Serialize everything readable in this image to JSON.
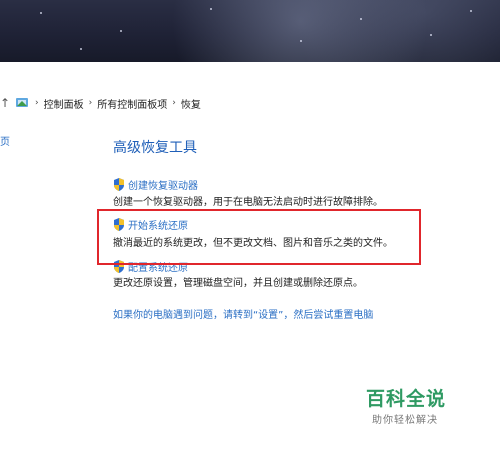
{
  "breadcrumb": {
    "items": [
      "控制面板",
      "所有控制面板项",
      "恢复"
    ]
  },
  "sidebar": {
    "cut_text": "页"
  },
  "main": {
    "heading": "高级恢复工具",
    "items": [
      {
        "link": "创建恢复驱动器",
        "desc": "创建一个恢复驱动器，用于在电脑无法启动时进行故障排除。"
      },
      {
        "link": "开始系统还原",
        "desc": "撤消最近的系统更改，但不更改文档、图片和音乐之类的文件。"
      },
      {
        "link": "配置系统还原",
        "desc": "更改还原设置，管理磁盘空间，并且创建或删除还原点。"
      }
    ],
    "bottom_link": "如果你的电脑遇到问题，请转到“设置”，然后尝试重置电脑"
  },
  "watermark": {
    "title": "百科全说",
    "subtitle": "助你轻松解决"
  },
  "colors": {
    "link": "#2b6fc4",
    "heading": "#1f5fb8",
    "highlight": "#e0262c",
    "watermark": "#2f9a63"
  },
  "icons": {
    "up": "up-arrow-icon",
    "location": "control-panel-icon",
    "item": "uac-shield-icon"
  }
}
